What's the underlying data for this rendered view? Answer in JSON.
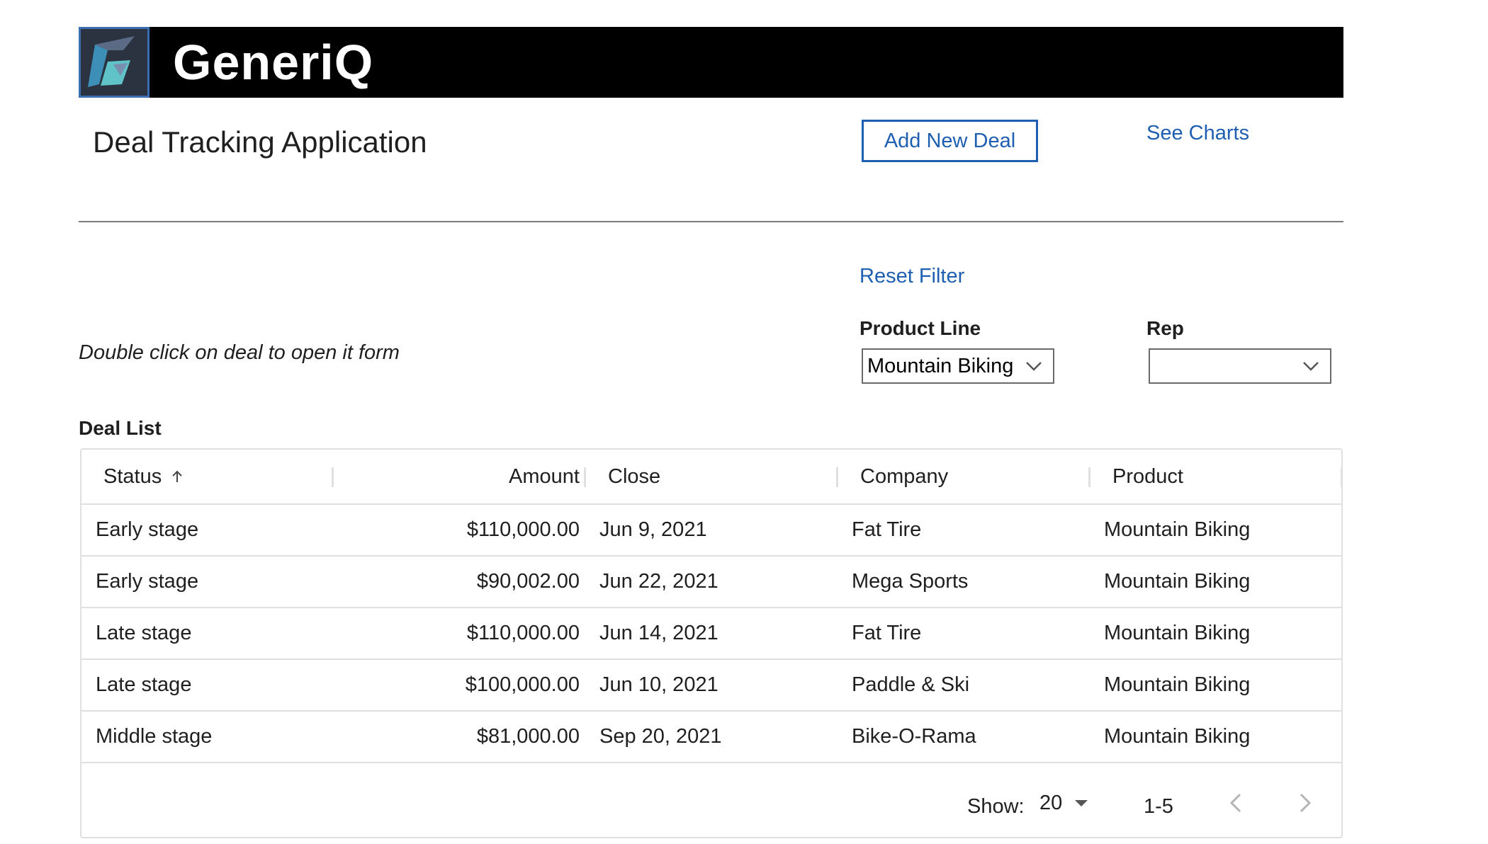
{
  "header": {
    "brand": "GeneriQ",
    "logo_icon": "generiq-logo-icon",
    "banner_color": "#000000"
  },
  "app": {
    "title": "Deal Tracking Application",
    "add_button": "Add New Deal",
    "see_charts": "See Charts",
    "accent": "#1f5fb1"
  },
  "filters": {
    "reset": "Reset Filter",
    "hint": "Double click on deal to open it form",
    "product_line_label": "Product Line",
    "product_line_value": "Mountain Biking",
    "rep_label": "Rep",
    "rep_value": ""
  },
  "deal_list": {
    "title": "Deal List",
    "columns": {
      "status": "Status",
      "amount": "Amount",
      "close": "Close",
      "company": "Company",
      "product": "Product"
    },
    "sort_icon": "arrow-up-icon",
    "rows": [
      {
        "status": "Early stage",
        "amount": "$110,000.00",
        "close": "Jun 9, 2021",
        "company": "Fat Tire",
        "product": "Mountain Biking"
      },
      {
        "status": "Early stage",
        "amount": "$90,002.00",
        "close": "Jun 22, 2021",
        "company": "Mega Sports",
        "product": "Mountain Biking"
      },
      {
        "status": "Late stage",
        "amount": "$110,000.00",
        "close": "Jun 14, 2021",
        "company": "Fat Tire",
        "product": "Mountain Biking"
      },
      {
        "status": "Late stage",
        "amount": "$100,000.00",
        "close": "Jun 10, 2021",
        "company": "Paddle & Ski",
        "product": "Mountain Biking"
      },
      {
        "status": "Middle stage",
        "amount": "$81,000.00",
        "close": "Sep 20, 2021",
        "company": "Bike-O-Rama",
        "product": "Mountain Biking"
      }
    ],
    "pagination": {
      "show_label": "Show:",
      "page_size": "20",
      "range": "1-5"
    }
  }
}
